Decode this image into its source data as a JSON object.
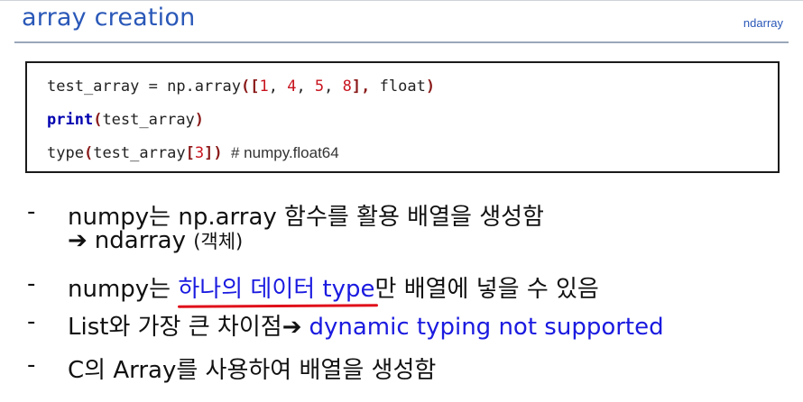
{
  "header": {
    "title": "array creation",
    "section_tag": "ndarray",
    "accent_color": "#2a58b8"
  },
  "code": {
    "line1": {
      "var": "test_array",
      "op": " = ",
      "call": "np.array",
      "open": "([",
      "n1": "1",
      "c1": ", ",
      "n2": "4",
      "c2": ", ",
      "n3": "5",
      "c3": ", ",
      "n4": "8",
      "close": "], ",
      "arg": "float",
      "end": ")"
    },
    "line2": {
      "kw": "print",
      "open": "(",
      "arg": "test_array",
      "end": ")"
    },
    "line3": {
      "call": "type",
      "open": "(",
      "arg": "test_array",
      "lb": "[",
      "idx": "3",
      "rb": "]",
      "end": ")",
      "comment": "  # numpy.float64"
    }
  },
  "bullets": {
    "dash": "-",
    "b1": "numpy는 np.array 함수를 활용 배열을 생성함",
    "b1_arrow": "➔",
    "b1_result": "ndarray",
    "b1_note": "(객체)",
    "b2_pre": "numpy는 ",
    "b2_highlight": "하나의 데이터 type",
    "b2_post": "만 배열에 넣을 수 있음",
    "b3_pre": "List와 가장 큰 차이점",
    "b3_arrow": "➔",
    "b3_highlight": "dynamic typing not supported",
    "b4": "C의 Array를 사용하여 배열을 생성함"
  }
}
